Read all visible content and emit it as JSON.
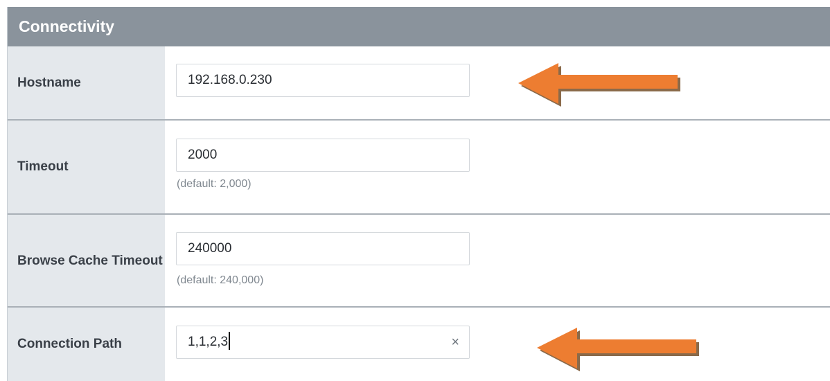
{
  "section": {
    "title": "Connectivity"
  },
  "fields": [
    {
      "label": "Hostname",
      "value": "192.168.0.230",
      "hint": ""
    },
    {
      "label": "Timeout",
      "value": "2000",
      "hint": "(default: 2,000)"
    },
    {
      "label": "Browse Cache Timeout",
      "value": "240000",
      "hint": "(default: 240,000)"
    },
    {
      "label": "Connection Path",
      "value": "1,1,2,3",
      "hint": "",
      "clear_icon": "×"
    }
  ],
  "annotations": {
    "arrow_color": "#ed7d31",
    "arrow_shadow": "#8a6a4a"
  }
}
